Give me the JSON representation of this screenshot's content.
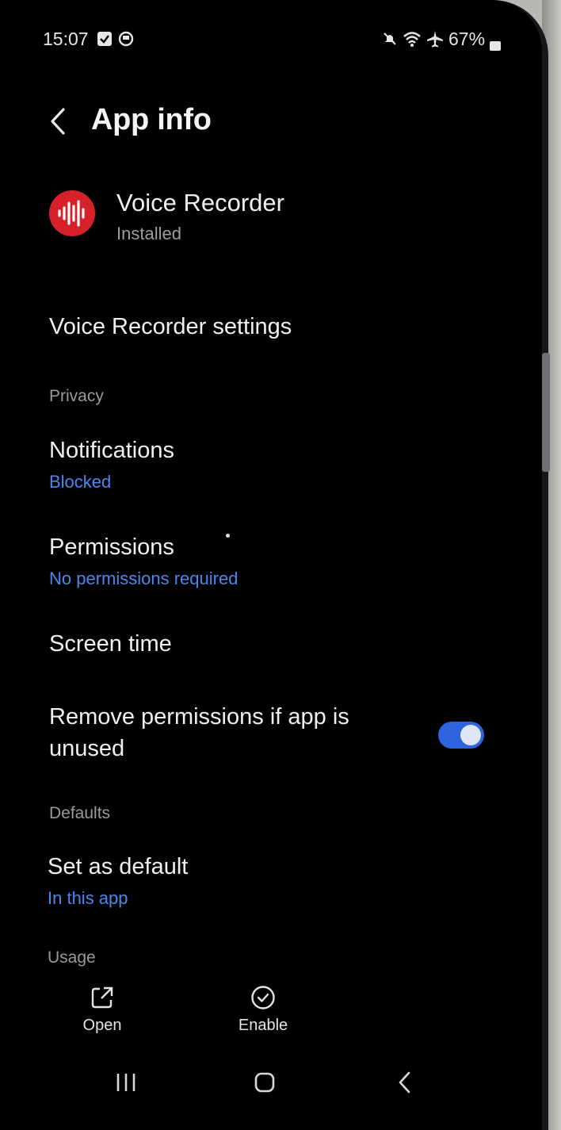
{
  "status_bar": {
    "time": "15:07",
    "battery": "67%",
    "icons": [
      "screenshot-icon",
      "app-notification-icon",
      "mute-icon",
      "wifi-icon",
      "airplane-mode-icon",
      "battery-icon"
    ]
  },
  "header": {
    "title": "App info",
    "back_icon": "back-arrow-icon"
  },
  "app": {
    "name": "Voice Recorder",
    "status": "Installed",
    "icon": "voice-recorder-icon",
    "icon_color": "#d6212a"
  },
  "items": {
    "app_settings": "Voice Recorder settings",
    "privacy_header": "Privacy",
    "notifications": {
      "title": "Notifications",
      "value": "Blocked"
    },
    "permissions": {
      "title": "Permissions",
      "value": "No permissions required"
    },
    "screen_time": "Screen time",
    "remove_permissions": {
      "line1": "Remove permissions if app is",
      "line2": "unused",
      "enabled": true
    },
    "defaults_header": "Defaults",
    "set_default": {
      "title": "Set as default",
      "value": "In this app"
    },
    "usage_header": "Usage"
  },
  "actions": {
    "open": "Open",
    "enable": "Enable"
  },
  "colors": {
    "accent": "#4b87f0",
    "toggle_on": "#2e64de",
    "background": "#000000"
  },
  "nav_bar": [
    "recents-icon",
    "home-icon",
    "back-icon"
  ]
}
